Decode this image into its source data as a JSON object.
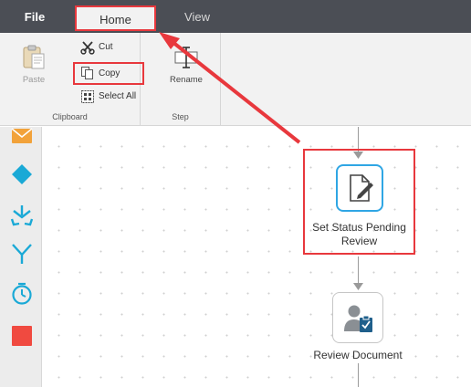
{
  "tabs": {
    "file": "File",
    "home": "Home",
    "view": "View"
  },
  "ribbon": {
    "clipboard": {
      "label": "Clipboard",
      "paste": "Paste",
      "cut": "Cut",
      "copy": "Copy",
      "select_all": "Select All"
    },
    "step": {
      "label": "Step",
      "rename": "Rename"
    }
  },
  "palette": {
    "items": [
      "envelope-icon",
      "diamond-icon",
      "split-icon",
      "merge-icon",
      "timer-icon",
      "stop-icon"
    ]
  },
  "workflow": {
    "node1_label_line1": "Set Status Pending",
    "node1_label_line2": "Review",
    "node2_label": "Review Document"
  },
  "colors": {
    "tabbar": "#4b4e55",
    "ribbon": "#f2f2f2",
    "highlight": "#e8383d",
    "accent": "#2fa6e4",
    "palette_icon": "#1aa9d6",
    "envelope": "#f2a23a",
    "stop": "#f04a40"
  }
}
